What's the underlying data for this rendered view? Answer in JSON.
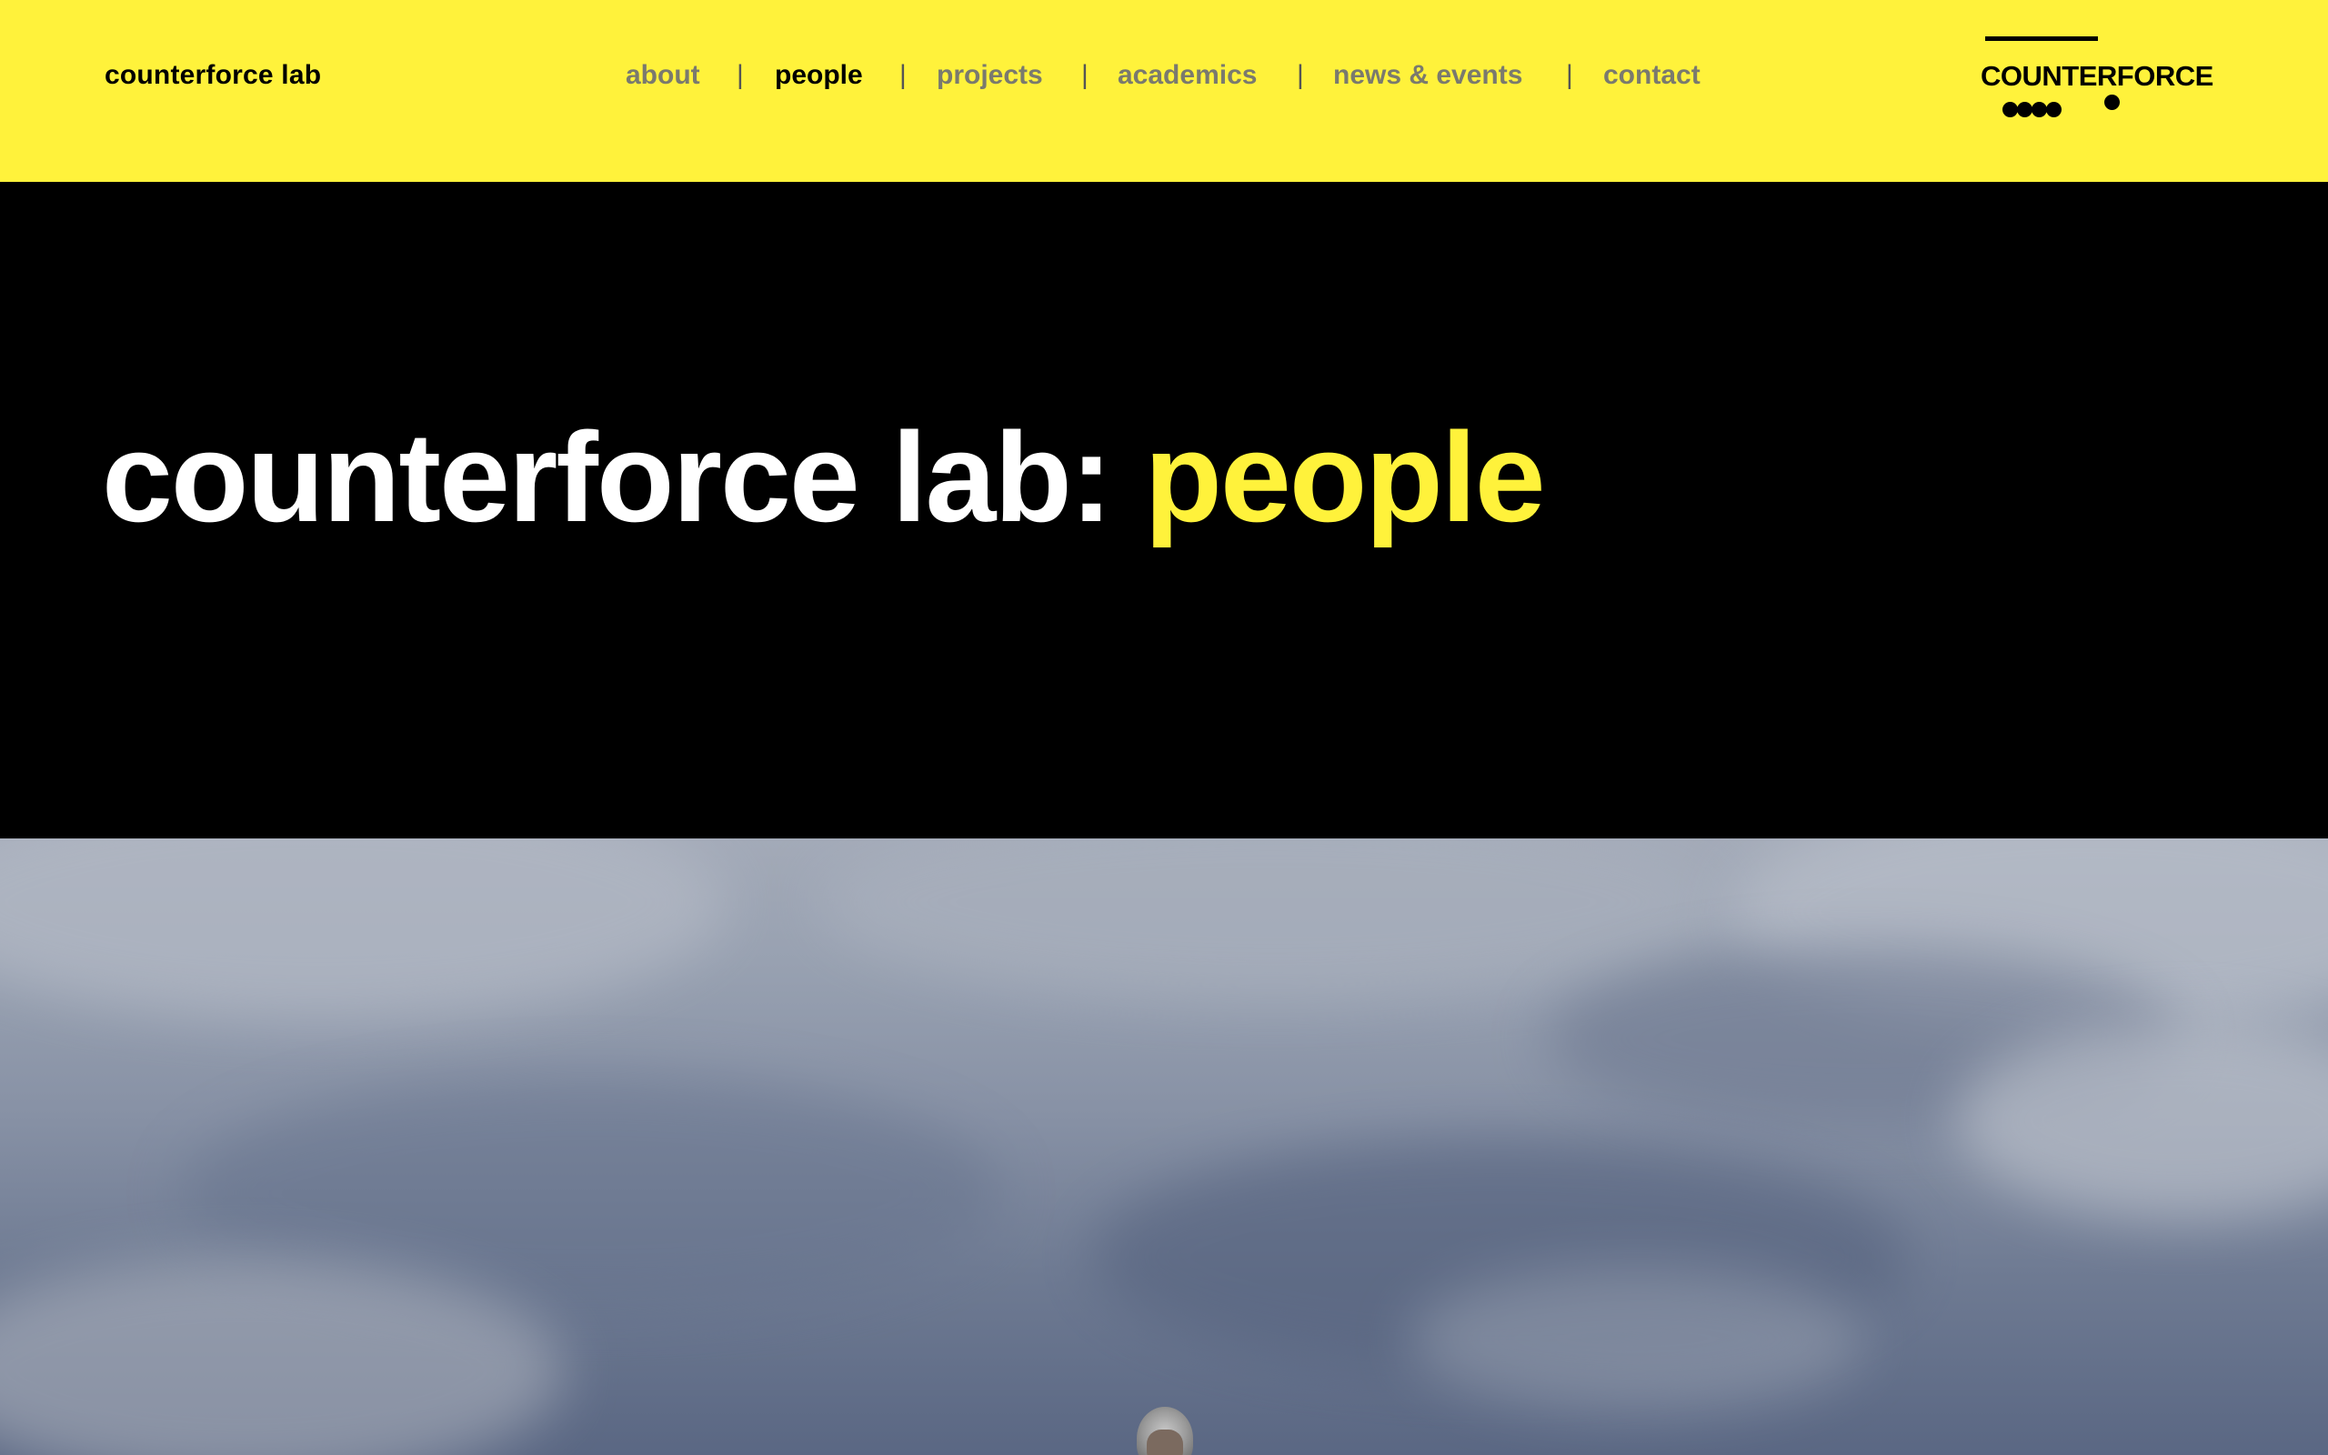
{
  "header": {
    "site_title": "counterforce lab",
    "nav": [
      {
        "label": "about",
        "active": false
      },
      {
        "label": "people",
        "active": true
      },
      {
        "label": "projects",
        "active": false
      },
      {
        "label": "academics",
        "active": false
      },
      {
        "label": "news & events",
        "active": false
      },
      {
        "label": "contact",
        "active": false
      }
    ],
    "separator": "|",
    "logo_text": "COUNTERFORCE"
  },
  "hero": {
    "title_prefix": "counterforce lab:",
    "title_highlight": "people"
  },
  "colors": {
    "accent": "#fff23b",
    "header_bg": "#fff23b",
    "hero_bg": "#000000",
    "nav_inactive": "#7a7a6e",
    "nav_active": "#000000"
  },
  "photo": {
    "icon": "landscape-photo"
  }
}
